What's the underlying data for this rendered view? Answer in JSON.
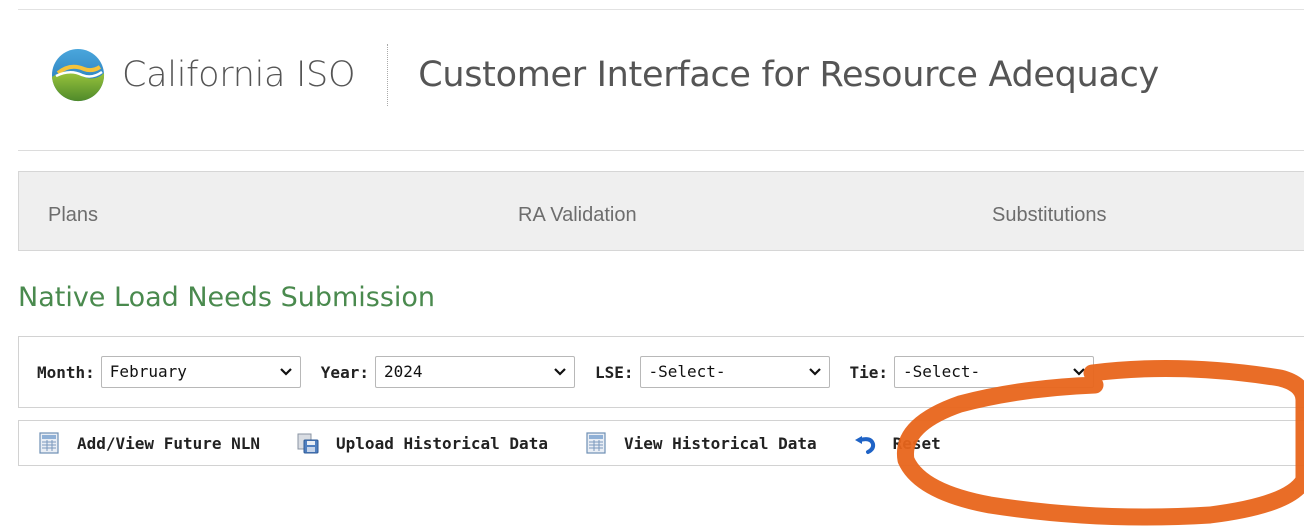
{
  "header": {
    "brand": "California ISO",
    "app_title": "Customer Interface for Resource Adequacy",
    "logo_icon": "california-iso-logo"
  },
  "nav": {
    "items": [
      {
        "label": "Plans"
      },
      {
        "label": "RA Validation"
      },
      {
        "label": "Substitutions"
      }
    ]
  },
  "page": {
    "title": "Native Load Needs Submission"
  },
  "filters": {
    "month": {
      "label": "Month:",
      "value": "February"
    },
    "year": {
      "label": "Year:",
      "value": "2024"
    },
    "lse": {
      "label": "LSE:",
      "value": "-Select-"
    },
    "tie": {
      "label": "Tie:",
      "value": "-Select-"
    }
  },
  "toolbar": {
    "add_future_nln": {
      "label": "Add/View Future NLN",
      "icon": "grid-document-icon"
    },
    "upload_historical": {
      "label": "Upload Historical Data",
      "icon": "upload-document-icon"
    },
    "view_historical": {
      "label": "View Historical Data",
      "icon": "grid-document-icon"
    },
    "reset": {
      "label": "Reset",
      "icon": "undo-arrow-icon"
    }
  },
  "colors": {
    "title_green": "#4a8a4e",
    "annotation_orange": "#e8651b",
    "reset_blue": "#1f63c6"
  }
}
